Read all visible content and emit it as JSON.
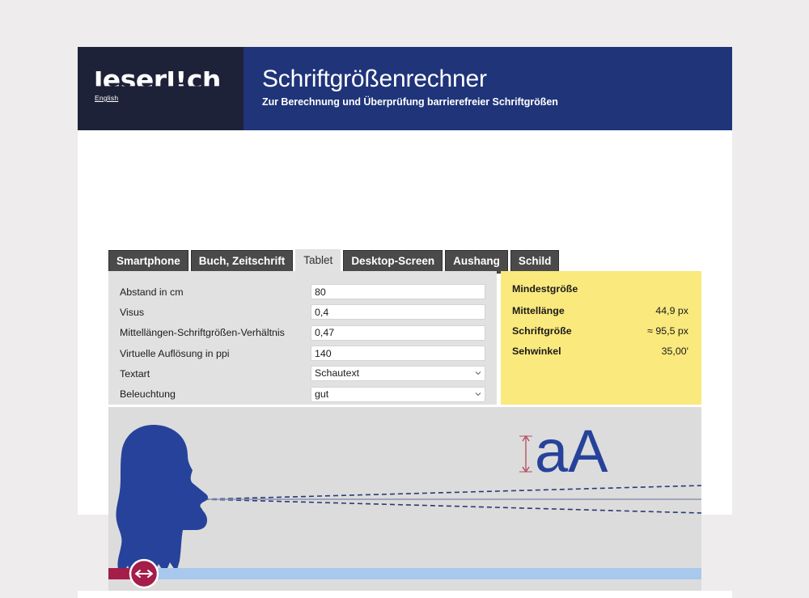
{
  "brand": {
    "wordmark": "leserl!ch",
    "language_link": "English"
  },
  "header": {
    "title": "Schriftgrößenrechner",
    "subtitle": "Zur Berechnung und Überprüfung barrierefreier Schriftgrößen",
    "brand_bg": "#1d2238",
    "title_bg": "#1f3479"
  },
  "tabs": [
    {
      "label": "Smartphone",
      "active": false
    },
    {
      "label": "Buch, Zeitschrift",
      "active": false
    },
    {
      "label": "Tablet",
      "active": true
    },
    {
      "label": "Desktop-Screen",
      "active": false
    },
    {
      "label": "Aushang",
      "active": false
    },
    {
      "label": "Schild",
      "active": false
    }
  ],
  "form": {
    "rows": [
      {
        "label": "Abstand in cm",
        "value": "80",
        "type": "text"
      },
      {
        "label": "Visus",
        "value": "0,4",
        "type": "text"
      },
      {
        "label": "Mittellängen-Schriftgrößen-Verhältnis",
        "value": "0,47",
        "type": "text"
      },
      {
        "label": "Virtuelle Auflösung in ppi",
        "value": "140",
        "type": "text"
      },
      {
        "label": "Textart",
        "value": "Schautext",
        "type": "select"
      },
      {
        "label": "Beleuchtung",
        "value": "gut",
        "type": "select"
      }
    ]
  },
  "results": {
    "heading": "Mindestgröße",
    "bg": "#fae97d",
    "rows": [
      {
        "key": "Mittellänge",
        "value": "44,9 px"
      },
      {
        "key": "Schriftgröße",
        "value": "≈ 95,5 px"
      },
      {
        "key": "Sehwinkel",
        "value": "35,00'"
      }
    ]
  },
  "illustration": {
    "bg": "#dcdcdc",
    "head_color": "#27429a",
    "sample_text": "aA",
    "sample_color": "#27429a",
    "slider_track_color": "#a8c8ee",
    "slider_fill_color": "#a51d49",
    "slider_handle_color": "#a51d49",
    "measure_color": "#b33b52",
    "sightline_color": "#2a3a75"
  }
}
